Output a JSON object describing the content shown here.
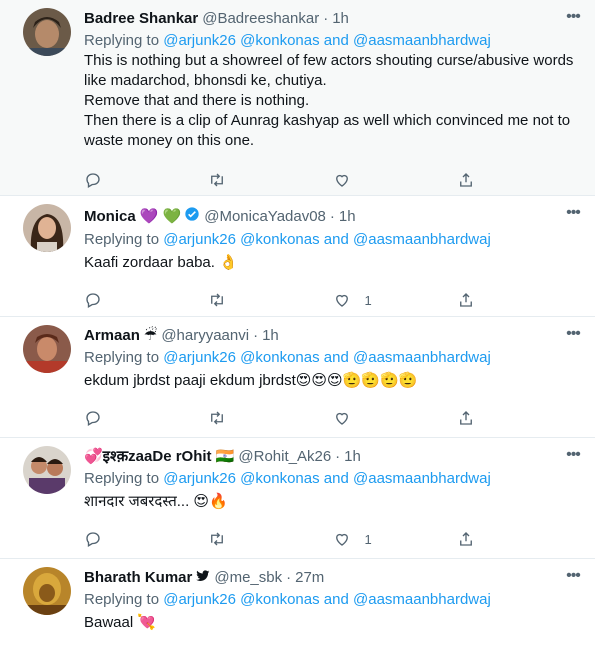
{
  "replying_prefix": "Replying to",
  "tweets": [
    {
      "name": "Badree Shankar",
      "handle": "@Badreeshankar",
      "dot": "·",
      "time": "1h",
      "mentions": [
        "@arjunk26",
        "@konkonas",
        "and",
        "@aasmaanbhardwaj"
      ],
      "lines": [
        "This is nothing but a showreel of few actors shouting curse/abusive words",
        "like madarchod, bhonsdi ke, chutiya.",
        "Remove that and there is nothing.",
        "Then there is a clip of Aunrag kashyap as well which convinced me not to",
        "waste money on this one."
      ],
      "likes": ""
    },
    {
      "name": "Monica",
      "name_emoji": "💜 💚",
      "verified": true,
      "handle": "@MonicaYadav08",
      "dot": "·",
      "time": "1h",
      "mentions": [
        "@arjunk26",
        "@konkonas",
        "and",
        "@aasmaanbhardwaj"
      ],
      "lines": [
        "Kaafi zordaar baba. 👌"
      ],
      "likes": "1"
    },
    {
      "name": "Armaan",
      "name_emoji": "☔",
      "handle": "@haryyaanvi",
      "dot": "·",
      "time": "1h",
      "mentions": [
        "@arjunk26",
        "@konkonas",
        "and",
        "@aasmaanbhardwaj"
      ],
      "lines": [
        "ekdum jbrdst paaji ekdum jbrdst😍😍😍🫡🫡🫡🫡"
      ],
      "likes": ""
    },
    {
      "name": "💞इश्क़zaaDe rOhit 🇮🇳",
      "handle": "@Rohit_Ak26",
      "dot": "·",
      "time": "1h",
      "mentions": [
        "@arjunk26",
        "@konkonas",
        "and",
        "@aasmaanbhardwaj"
      ],
      "lines": [
        "शानदार जबरदस्त... 😍🔥"
      ],
      "likes": "1"
    },
    {
      "name": "Bharath Kumar",
      "name_emoji": "🐦",
      "handle": "@me_sbk",
      "dot": "·",
      "time": "27m",
      "mentions": [
        "@arjunk26",
        "@konkonas",
        "and",
        "@aasmaanbhardwaj"
      ],
      "lines": [
        "Bawaal 💘"
      ],
      "likes": ""
    }
  ],
  "colors": {
    "accent": "#1d9bf0",
    "secondary_text": "#536471",
    "highlight_bg": "#f7f9f9",
    "divider": "#e6ecf0"
  }
}
